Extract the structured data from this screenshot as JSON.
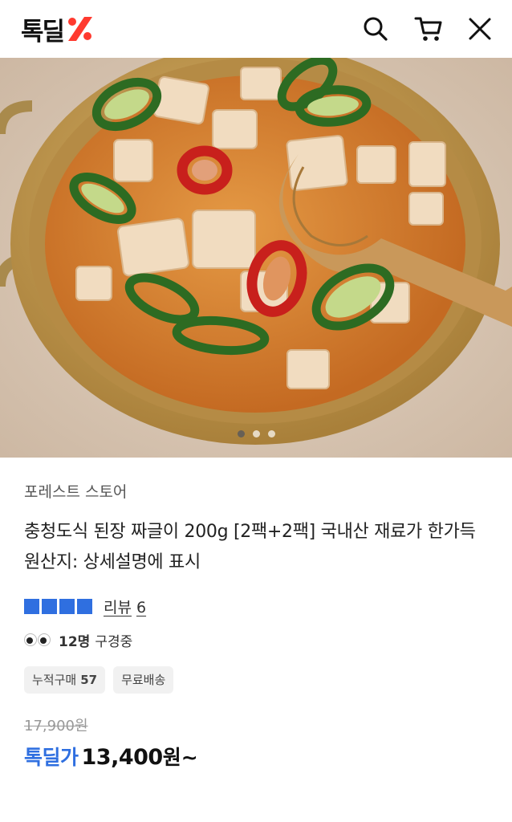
{
  "header": {
    "logo_text": "톡딜",
    "icons": [
      "search-icon",
      "cart-icon",
      "close-icon"
    ],
    "accent_color": "#ff3a2f"
  },
  "hero": {
    "image_count": 3,
    "active_index": 1
  },
  "product": {
    "store": "포레스트 스토어",
    "title": "충청도식 된장 짜글이 200g [2팩+2팩] 국내산 재료가 한가득",
    "origin": "원산지: 상세설명에 표시",
    "rating_stars": 4,
    "review_label": "리뷰",
    "review_count": "6",
    "viewers_count": "12명",
    "viewers_suffix": "구경중",
    "tags": [
      {
        "label": "누적구매",
        "value": "57"
      },
      {
        "label": "무료배송",
        "value": ""
      }
    ],
    "original_price": "17,900원",
    "sale_label": "톡딜가",
    "sale_price": "13,400",
    "sale_unit": "원~",
    "accent_color": "#2f6fe0"
  }
}
